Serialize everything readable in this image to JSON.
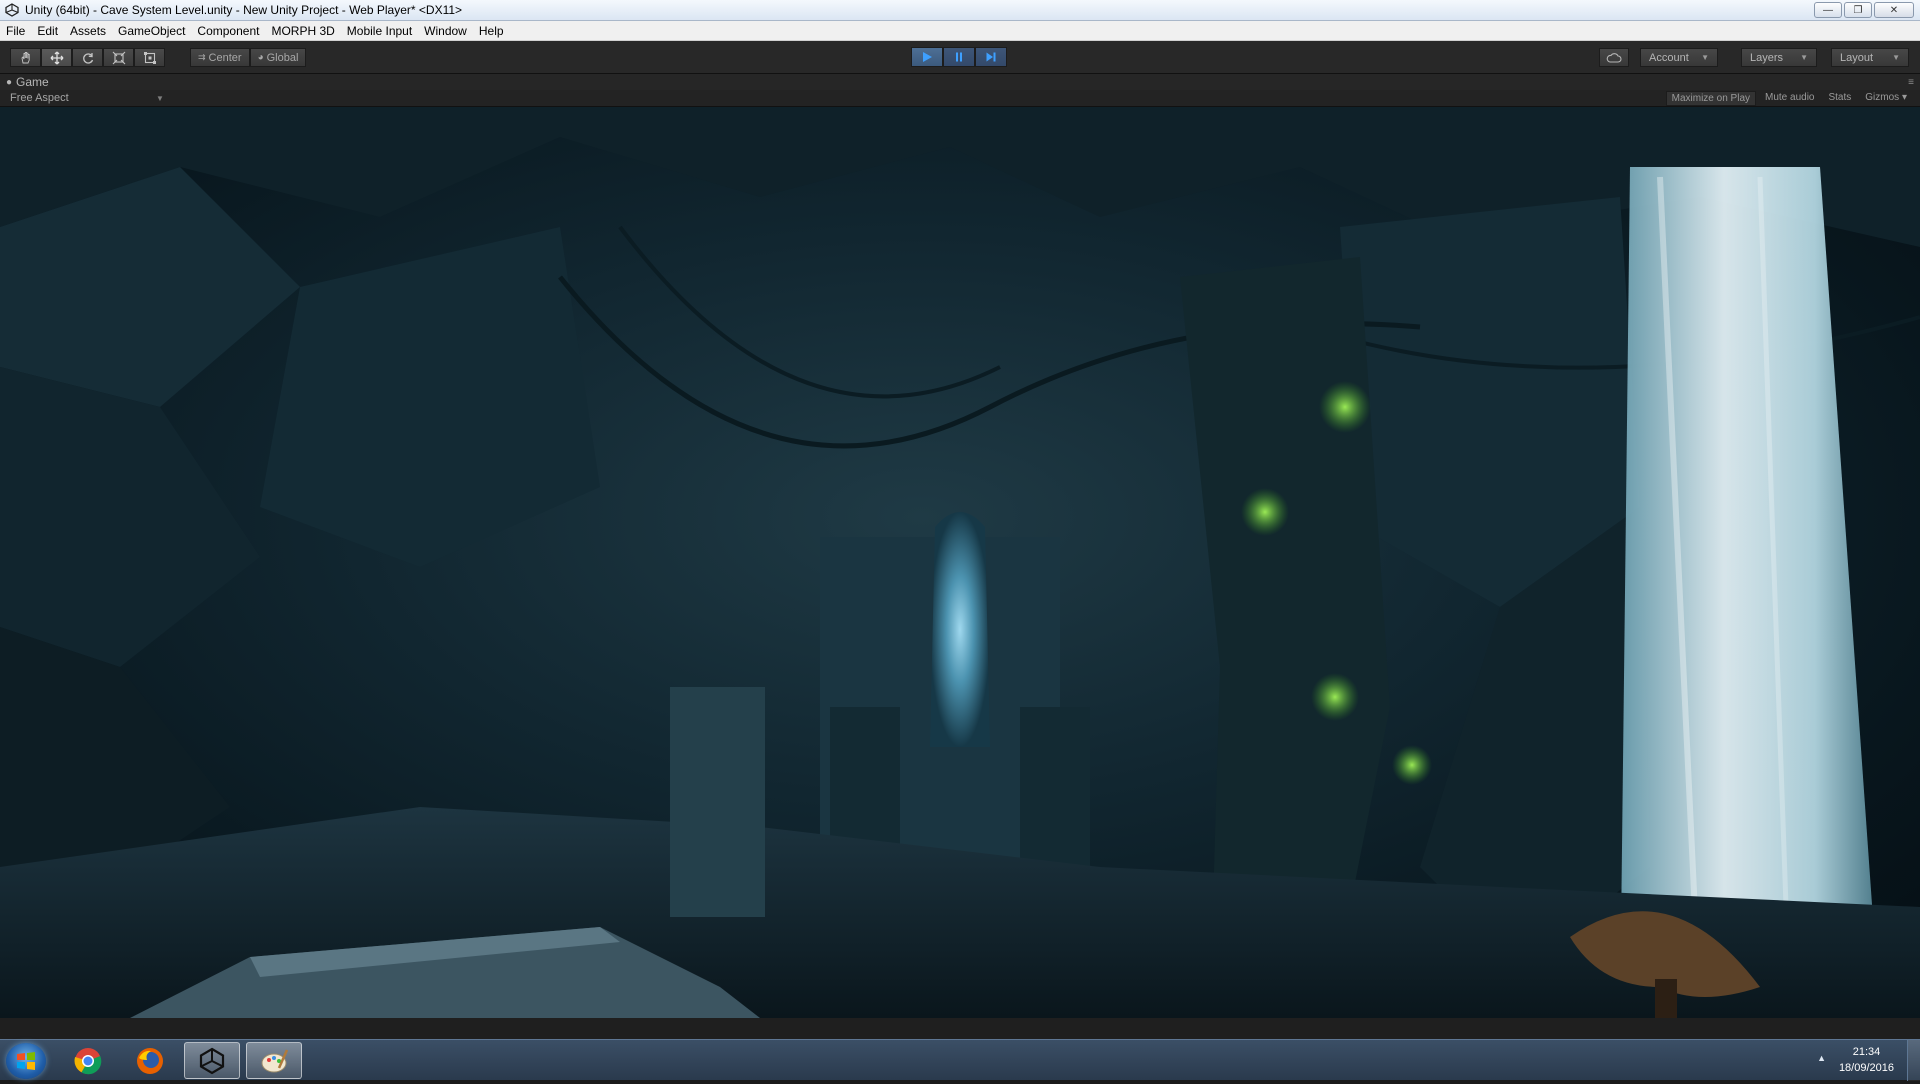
{
  "window": {
    "title": "Unity (64bit) - Cave System Level.unity - New Unity Project - Web Player* <DX11>",
    "controls": [
      "minimize",
      "restore",
      "close"
    ]
  },
  "menu": [
    "File",
    "Edit",
    "Assets",
    "GameObject",
    "Component",
    "MORPH 3D",
    "Mobile Input",
    "Window",
    "Help"
  ],
  "toolbar": {
    "tools": [
      "hand-icon",
      "move-icon",
      "rotate-icon",
      "scale-icon",
      "rect-icon"
    ],
    "pivot_label": "Center",
    "space_label": "Global",
    "play": "play-icon",
    "pause": "pause-icon",
    "step": "step-icon",
    "cloud": "cloud-icon",
    "account_label": "Account",
    "layers_label": "Layers",
    "layout_label": "Layout"
  },
  "game_view": {
    "tab_label": "Game",
    "aspect_label": "Free Aspect",
    "options": [
      "Maximize on Play",
      "Mute audio",
      "Stats",
      "Gizmos"
    ]
  },
  "taskbar": {
    "apps": [
      "chrome-icon",
      "firefox-icon",
      "unity-icon",
      "paint-icon"
    ],
    "time": "21:34",
    "date": "18/09/2016"
  },
  "colors": {
    "play_active": "#4d6f95",
    "editor_dark": "#282828",
    "taskbar": "#2a3a4d"
  }
}
